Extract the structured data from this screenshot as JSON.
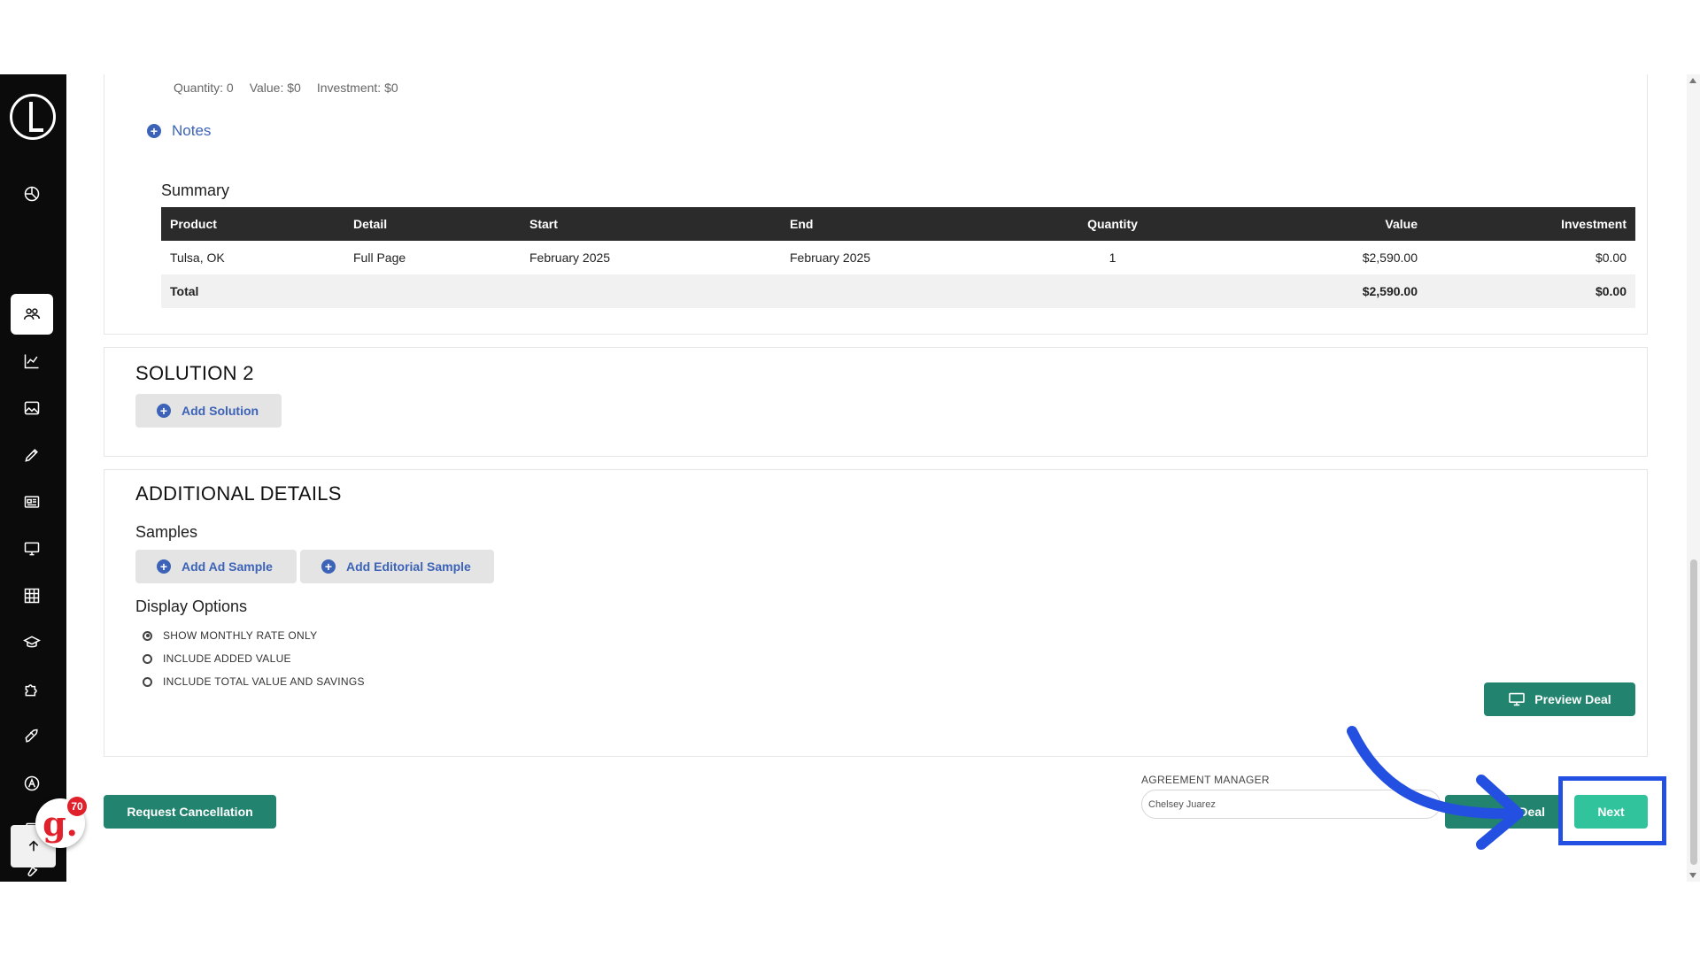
{
  "solution1": {
    "meta": {
      "quantity": "Quantity: 0",
      "value": "Value: $0",
      "investment": "Investment: $0"
    },
    "notes_label": "Notes",
    "summary": {
      "title": "Summary",
      "headers": [
        "Product",
        "Detail",
        "Start",
        "End",
        "Quantity",
        "Value",
        "Investment"
      ],
      "rows": [
        [
          "Tulsa, OK",
          "Full Page",
          "February 2025",
          "February 2025",
          "1",
          "$2,590.00",
          "$0.00"
        ]
      ],
      "total": {
        "label": "Total",
        "value": "$2,590.00",
        "investment": "$0.00"
      }
    }
  },
  "solution2": {
    "title": "SOLUTION 2",
    "add_solution_label": "Add Solution"
  },
  "additional": {
    "title": "ADDITIONAL DETAILS",
    "samples_title": "Samples",
    "add_ad_sample_label": "Add Ad Sample",
    "add_editorial_sample_label": "Add Editorial Sample",
    "display_options_title": "Display Options",
    "options": [
      {
        "label": "SHOW MONTHLY RATE ONLY",
        "selected": true
      },
      {
        "label": "INCLUDE ADDED VALUE",
        "selected": false
      },
      {
        "label": "INCLUDE TOTAL VALUE AND SAVINGS",
        "selected": false
      }
    ],
    "preview_deal_label": "Preview Deal"
  },
  "footer": {
    "request_cancellation_label": "Request Cancellation",
    "agreement_manager_label": "AGREEMENT MANAGER",
    "agreement_manager_value": "Chelsey Juarez",
    "deal_label": "Deal",
    "next_label": "Next"
  },
  "badge": {
    "letter": "g.",
    "count": "70"
  },
  "colors": {
    "accent_teal": "#22836f",
    "next_teal": "#31c39c",
    "link_blue": "#3c63b8",
    "highlight_blue": "#2450e2",
    "sidebar": "#0b0b0b"
  },
  "sidebar": {
    "icons": [
      "logo-icon",
      "palette-icon",
      "users-icon",
      "chart-line-icon",
      "image-icon",
      "pencil-icon",
      "newspaper-icon",
      "monitor-icon",
      "grid-icon",
      "graduation-cap-icon",
      "puzzle-icon",
      "rocket-icon",
      "font-icon",
      "contact-book-icon",
      "wrench-icon",
      "arrow-up-icon"
    ]
  }
}
